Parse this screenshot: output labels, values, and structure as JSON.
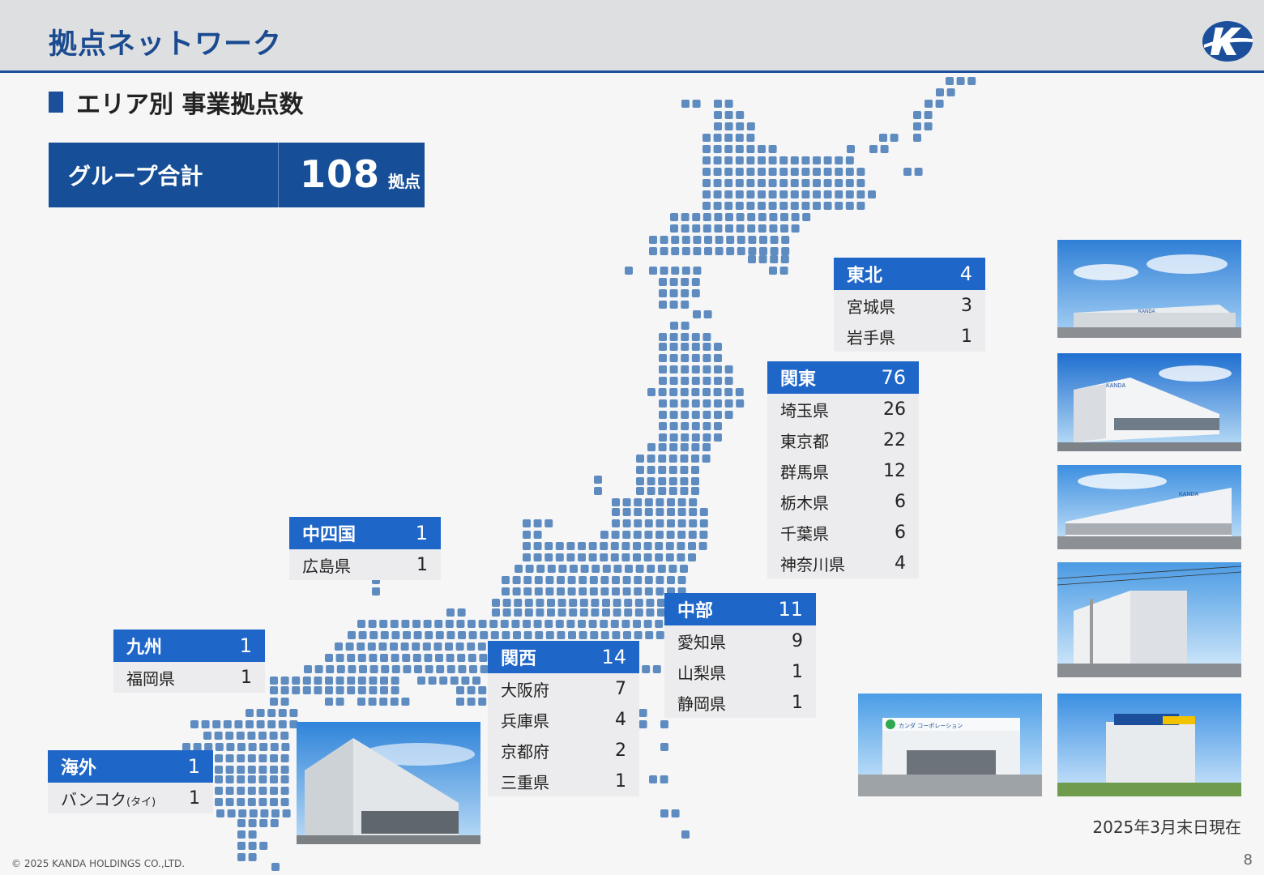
{
  "header": {
    "title": "拠点ネットワーク"
  },
  "section": {
    "title": "エリア別 事業拠点数"
  },
  "total": {
    "label": "グループ合計",
    "value": "108",
    "unit": "拠点"
  },
  "regions": {
    "tohoku": {
      "name": "東北",
      "count": "4",
      "rows": [
        {
          "pref": "宮城県",
          "count": "3"
        },
        {
          "pref": "岩手県",
          "count": "1"
        }
      ]
    },
    "kanto": {
      "name": "関東",
      "count": "76",
      "rows": [
        {
          "pref": "埼玉県",
          "count": "26"
        },
        {
          "pref": "東京都",
          "count": "22"
        },
        {
          "pref": "群馬県",
          "count": "12"
        },
        {
          "pref": "栃木県",
          "count": "6"
        },
        {
          "pref": "千葉県",
          "count": "6"
        },
        {
          "pref": "神奈川県",
          "count": "4"
        }
      ]
    },
    "chushikoku": {
      "name": "中四国",
      "count": "1",
      "rows": [
        {
          "pref": "広島県",
          "count": "1"
        }
      ]
    },
    "chubu": {
      "name": "中部",
      "count": "11",
      "rows": [
        {
          "pref": "愛知県",
          "count": "9"
        },
        {
          "pref": "山梨県",
          "count": "1"
        },
        {
          "pref": "静岡県",
          "count": "1"
        }
      ]
    },
    "kyushu": {
      "name": "九州",
      "count": "1",
      "rows": [
        {
          "pref": "福岡県",
          "count": "1"
        }
      ]
    },
    "kansai": {
      "name": "関西",
      "count": "14",
      "rows": [
        {
          "pref": "大阪府",
          "count": "7"
        },
        {
          "pref": "兵庫県",
          "count": "4"
        },
        {
          "pref": "京都府",
          "count": "2"
        },
        {
          "pref": "三重県",
          "count": "1"
        }
      ]
    },
    "overseas": {
      "name": "海外",
      "count": "1",
      "rows": [
        {
          "pref": "バンコク",
          "suffix": "(タイ)",
          "count": "1"
        }
      ]
    }
  },
  "photo_signs": {
    "kanda": "KANDA",
    "kanda_kana": "カンダ コーポレーション"
  },
  "as_of": "2025年3月末日現在",
  "footer": {
    "copyright": "© 2025 KANDA HOLDINGS CO.,LTD.",
    "page": "8"
  },
  "colors": {
    "brand": "#164e97",
    "region_header": "#1f66c9",
    "map_dot": "#5f8cc0",
    "header_bg": "#dedfe1"
  }
}
